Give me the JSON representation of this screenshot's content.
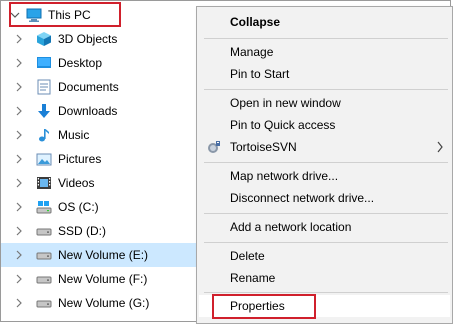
{
  "tree": {
    "items": [
      {
        "label": "This PC",
        "icon": "computer-icon",
        "expanded": true,
        "selected": false
      },
      {
        "label": "3D Objects",
        "icon": "cube-icon"
      },
      {
        "label": "Desktop",
        "icon": "desktop-icon"
      },
      {
        "label": "Documents",
        "icon": "documents-icon"
      },
      {
        "label": "Downloads",
        "icon": "download-icon"
      },
      {
        "label": "Music",
        "icon": "music-icon"
      },
      {
        "label": "Pictures",
        "icon": "pictures-icon"
      },
      {
        "label": "Videos",
        "icon": "videos-icon"
      },
      {
        "label": "OS (C:)",
        "icon": "drive-icon"
      },
      {
        "label": "SSD (D:)",
        "icon": "drive-icon"
      },
      {
        "label": "New Volume (E:)",
        "icon": "drive-icon",
        "selected": true
      },
      {
        "label": "New Volume (F:)",
        "icon": "drive-icon"
      },
      {
        "label": "New Volume (G:)",
        "icon": "drive-icon"
      }
    ]
  },
  "context_menu": {
    "collapse": "Collapse",
    "manage": "Manage",
    "pin_to_start": "Pin to Start",
    "open_new_window": "Open in new window",
    "pin_quick_access": "Pin to Quick access",
    "tortoise_svn": "TortoiseSVN",
    "map_network_drive": "Map network drive...",
    "disconnect_network_drive": "Disconnect network drive...",
    "add_network_location": "Add a network location",
    "delete": "Delete",
    "rename": "Rename",
    "properties": "Properties"
  },
  "colors": {
    "selection": "#cce8ff",
    "highlight_box": "#d0202c",
    "menu_bg": "#f2f2f2",
    "folder_blue": "#1e90ff"
  }
}
